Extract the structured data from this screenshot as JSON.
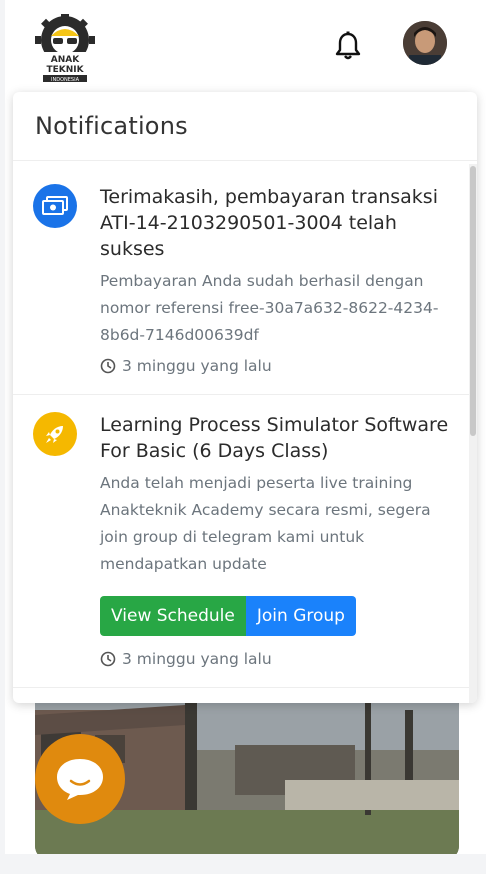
{
  "header": {
    "logo": {
      "line1": "ANAK",
      "line2": "TEKNIK",
      "line3": "INDONESIA"
    }
  },
  "icons": {
    "bell": "bell-icon",
    "avatar": "user-avatar",
    "chat": "chat-bubble-icon"
  },
  "colors": {
    "notif_blue": "#1a73e8",
    "notif_yellow": "#f5b800",
    "button_green": "#28a745",
    "button_blue": "#1a82fb",
    "chat_orange": "#e08a0e"
  },
  "notifications": {
    "title": "Notifications",
    "items": [
      {
        "icon": "money-icon",
        "title": "Terimakasih, pembayaran transaksi ATI-14-2103290501-3004 telah sukses",
        "body": "Pembayaran Anda sudah berhasil dengan nomor referensi free-30a7a632-8622-4234-8b6d-7146d00639df",
        "time": "3 minggu yang lalu"
      },
      {
        "icon": "rocket-icon",
        "title": "Learning Process Simulator Software For Basic (6 Days Class)",
        "body": "Anda telah menjadi peserta live training Anakteknik Academy secara resmi, segera join group di telegram kami untuk mendapatkan update",
        "buttons": [
          "View Schedule",
          "Join Group"
        ],
        "time": "3 minggu yang lalu"
      }
    ]
  }
}
